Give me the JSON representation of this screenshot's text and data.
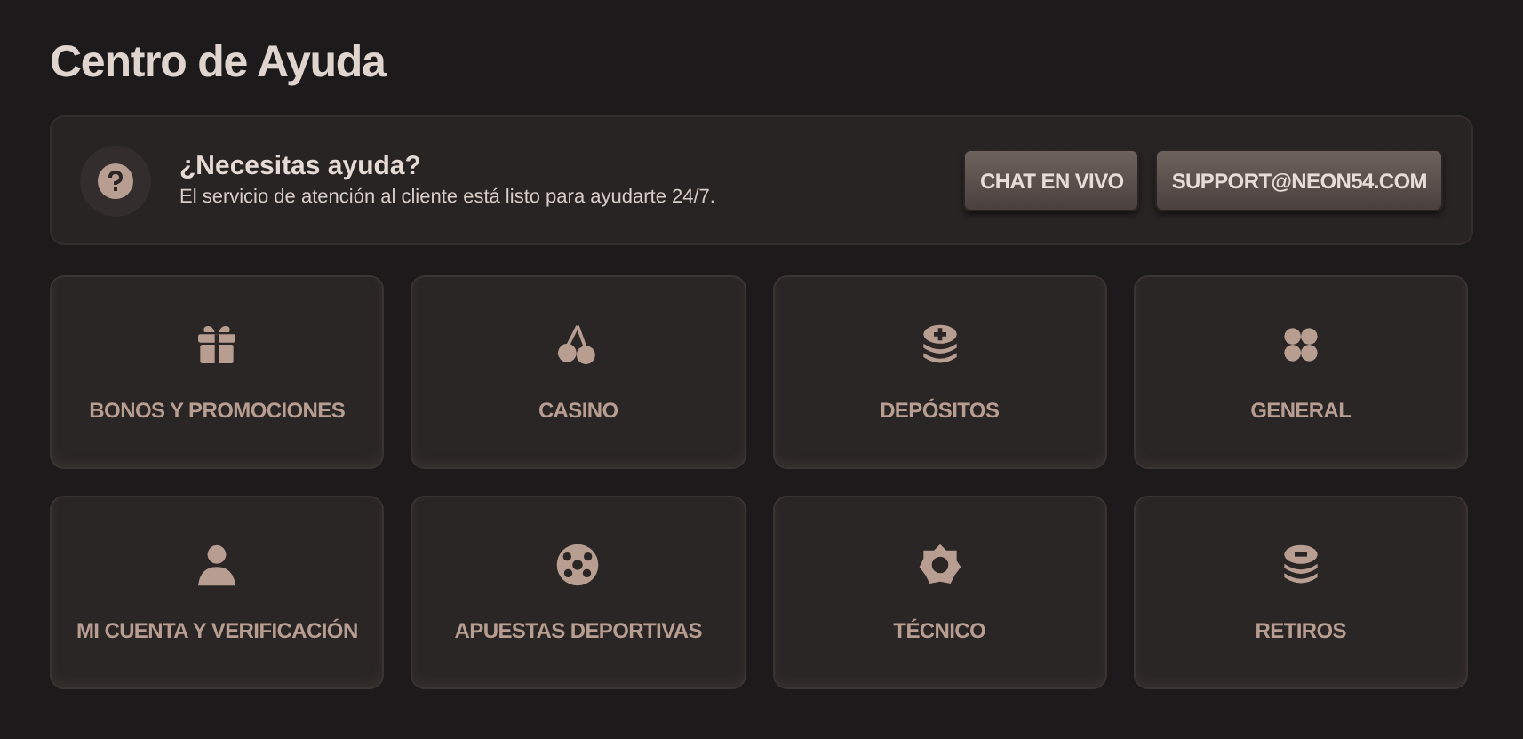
{
  "title": "Centro de Ayuda",
  "banner": {
    "heading": "¿Necesitas ayuda?",
    "text": "El servicio de atención al cliente está listo para ayudarte 24/7.",
    "buttons": [
      "CHAT EN VIVO",
      "SUPPORT@NEON54.COM"
    ]
  },
  "categories": [
    {
      "label": "BONOS Y PROMOCIONES",
      "kind": "gift"
    },
    {
      "label": "CASINO",
      "kind": "cherries"
    },
    {
      "label": "DEPÓSITOS",
      "kind": "deposit"
    },
    {
      "label": "GENERAL",
      "kind": "clover"
    },
    {
      "label": "MI CUENTA Y VERIFICACIÓN",
      "kind": "user"
    },
    {
      "label": "APUESTAS DEPORTIVAS",
      "kind": "ball"
    },
    {
      "label": "TÉCNICO",
      "kind": "gear"
    },
    {
      "label": "RETIROS",
      "kind": "withdraw"
    }
  ]
}
